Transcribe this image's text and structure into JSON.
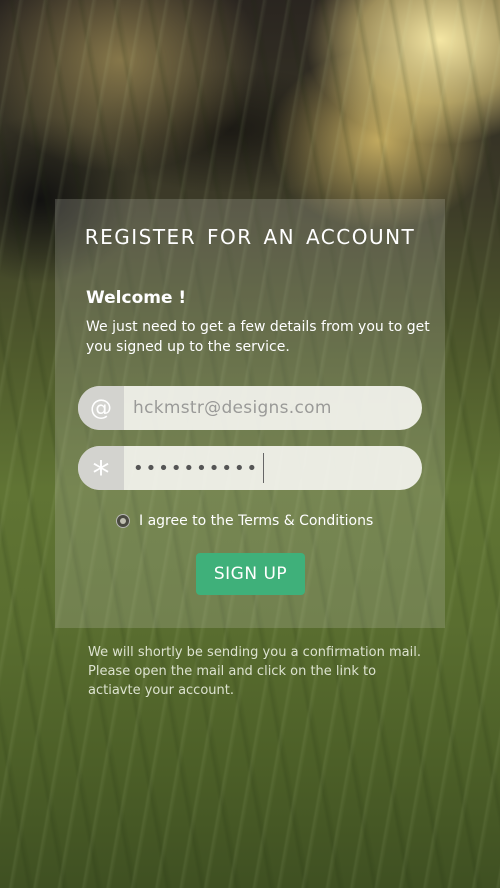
{
  "form": {
    "title": "REGISTER  FOR  AN  ACCOUNT",
    "welcome": "Welcome !",
    "intro": "We just need to get a few details from you to get you signed up to the service.",
    "email": {
      "icon": "at-icon",
      "icon_glyph": "@",
      "value": "hckmstr@designs.com"
    },
    "password": {
      "icon": "asterisk-icon",
      "icon_glyph": "*",
      "value": "••••••••••"
    },
    "terms_label": "I agree to the Terms & Conditions",
    "submit_label": "SIGN UP"
  },
  "footer_note": "We will shortly be sending you a confirmation mail. Please open the mail and click on the link to actiavte your account.",
  "colors": {
    "accent": "#3fb07a"
  }
}
